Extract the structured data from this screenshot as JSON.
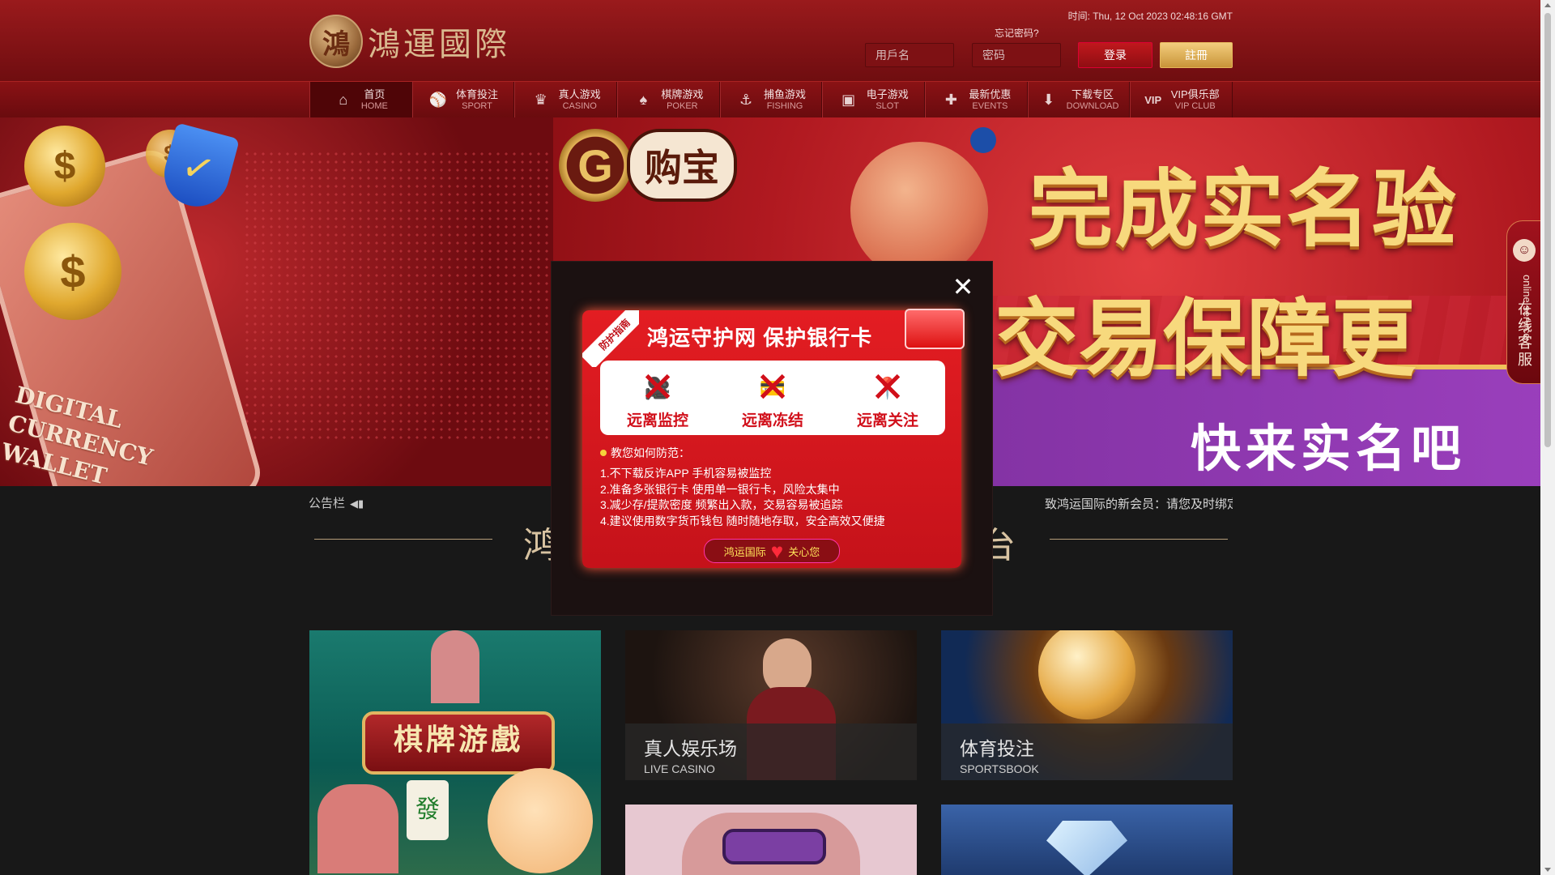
{
  "header": {
    "logo_seal": "鴻",
    "logo_text": "鴻運國際",
    "time_label": "时间: Thu, 12 Oct 2023 02:48:16 GMT",
    "forgot_password": "忘记密码?",
    "username_placeholder": "用戶名",
    "password_placeholder": "密码",
    "login_label": "登录",
    "register_label": "註冊"
  },
  "nav": {
    "items": [
      {
        "cn": "首页",
        "en": "HOME",
        "icon": "home-icon"
      },
      {
        "cn": "体育投注",
        "en": "SPORT",
        "icon": "sport-icon"
      },
      {
        "cn": "真人游戏",
        "en": "CASINO",
        "icon": "casino-icon"
      },
      {
        "cn": "棋牌游戏",
        "en": "POKER",
        "icon": "poker-icon"
      },
      {
        "cn": "捕鱼游戏",
        "en": "FISHING",
        "icon": "fishing-icon"
      },
      {
        "cn": "电子游戏",
        "en": "SLOT",
        "icon": "slot-icon"
      },
      {
        "cn": "最新优惠",
        "en": "EVENTS",
        "icon": "gift-icon"
      },
      {
        "cn": "下载专区",
        "en": "DOWNLOAD",
        "icon": "download-icon"
      },
      {
        "cn": "VIP俱乐部",
        "en": "VIP CLUB",
        "icon": "vip-icon"
      }
    ]
  },
  "banner": {
    "wallet_text_1": "DIGITAL",
    "wallet_text_2": "CURRENCY",
    "wallet_text_3": "WALLET",
    "brand_logo": "G",
    "brand_name": "购宝",
    "headline_1": "完成实名验",
    "headline_2": "交易保障更",
    "headline_3": "快来实名吧"
  },
  "service": {
    "label_en": "online service",
    "label_cn": "在线客服"
  },
  "notice": {
    "label": "公告栏",
    "marquee": "致鸿运国际的新会员：请您及时绑定"
  },
  "section": {
    "title_left": "鸿运",
    "title_right": "平台"
  },
  "tiles": {
    "poker_banner": "棋牌游戲",
    "casino_cn": "真人娱乐场",
    "casino_en": "LIVE CASINO",
    "sport_cn": "体育投注",
    "sport_en": "SPORTSBOOK"
  },
  "modal": {
    "corner_tag": "防护指南",
    "title": "鸿运守护网  保护银行卡",
    "features": [
      {
        "label": "远离监控",
        "icon": "camera-icon"
      },
      {
        "label": "远离冻结",
        "icon": "bank-card-icon"
      },
      {
        "label": "远离关注",
        "icon": "location-icon"
      }
    ],
    "tips_heading": "教您如何防范：",
    "tips": [
      "1.不下载反诈APP 手机容易被监控",
      "2.准备多张银行卡 使用单一银行卡，风险太集中",
      "3.减少存/提款密度 频繁出入款，交易容易被追踪",
      "4.建议使用数字货币钱包 随时随地存取，安全高效又便捷"
    ],
    "footer_left": "鸿运国际",
    "footer_right": "关心您"
  }
}
